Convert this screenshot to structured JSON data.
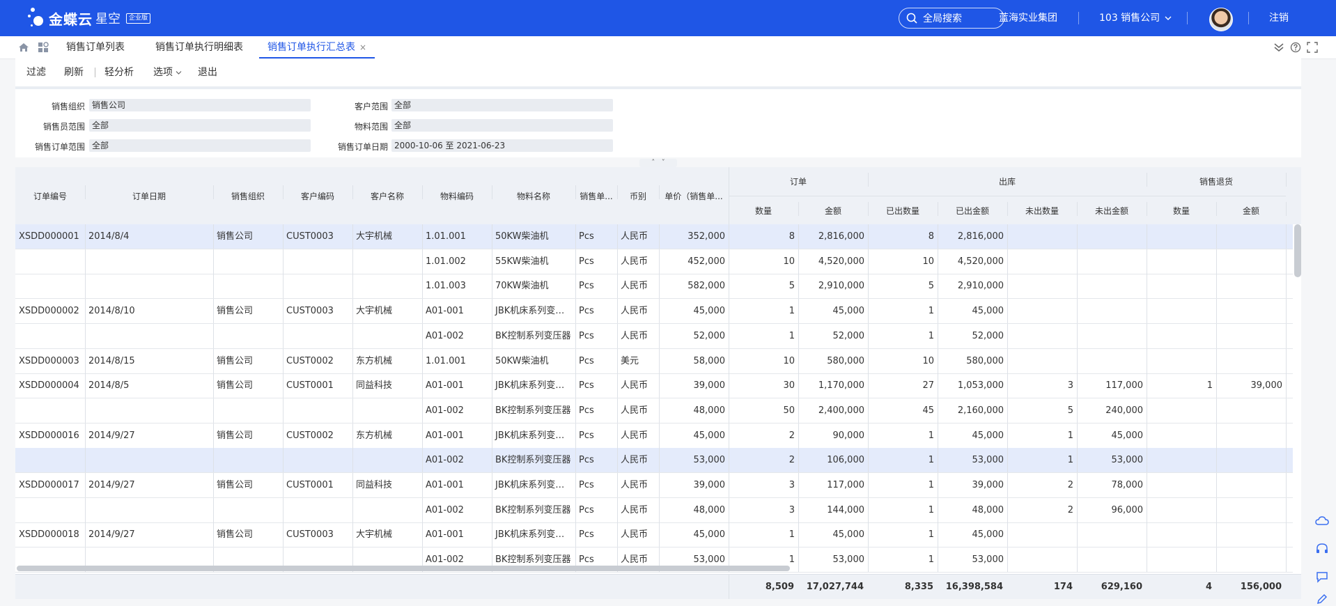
{
  "brand": {
    "name": "金蝶云",
    "sub": "星空",
    "badge": "企业版"
  },
  "topbar": {
    "search_label": "全局搜索",
    "group": "蓝海实业集团",
    "company": "103 销售公司",
    "logout": "注销"
  },
  "tabs": [
    {
      "label": "销售订单列表"
    },
    {
      "label": "销售订单执行明细表"
    },
    {
      "label": "销售订单执行汇总表",
      "close": "×"
    }
  ],
  "toolbar": {
    "filter": "过滤",
    "refresh": "刷新",
    "analysis": "轻分析",
    "options": "选项",
    "exit": "退出"
  },
  "filters": {
    "org": {
      "label": "销售组织",
      "value": "销售公司"
    },
    "sales_rep": {
      "label": "销售员范围",
      "value": "全部"
    },
    "order_range": {
      "label": "销售订单范围",
      "value": "全部"
    },
    "customer": {
      "label": "客户范围",
      "value": "全部"
    },
    "material": {
      "label": "物料范围",
      "value": "全部"
    },
    "date": {
      "label": "销售订单日期",
      "value": "2000-10-06 至 2021-06-23"
    }
  },
  "collapse": {
    "up": "˄",
    "down": "˅"
  },
  "columns": {
    "order_no": "订单编号",
    "order_date": "订单日期",
    "org": "销售组织",
    "cust_code": "客户编码",
    "cust_name": "客户名称",
    "mat_code": "物料编码",
    "mat_name": "物料名称",
    "unit": "销售单...",
    "currency": "币别",
    "price": "单价（销售单...",
    "group_order": "订单",
    "group_out": "出库",
    "group_return": "销售退货",
    "qty": "数量",
    "amount": "金额",
    "out_qty": "已出数量",
    "out_amount": "已出金额",
    "unout_qty": "未出数量",
    "unout_amount": "未出金额",
    "ret_qty": "数量",
    "ret_amount": "金额"
  },
  "rows": [
    [
      "XSDD000001",
      "2014/8/4",
      "销售公司",
      "CUST0003",
      "大宇机械",
      "1.01.001",
      "50KW柴油机",
      "Pcs",
      "人民币",
      "352,000",
      "8",
      "2,816,000",
      "8",
      "2,816,000",
      "",
      "",
      "",
      ""
    ],
    [
      "",
      "",
      "",
      "",
      "",
      "1.01.002",
      "55KW柴油机",
      "Pcs",
      "人民币",
      "452,000",
      "10",
      "4,520,000",
      "10",
      "4,520,000",
      "",
      "",
      "",
      ""
    ],
    [
      "",
      "",
      "",
      "",
      "",
      "1.01.003",
      "70KW柴油机",
      "Pcs",
      "人民币",
      "582,000",
      "5",
      "2,910,000",
      "5",
      "2,910,000",
      "",
      "",
      "",
      ""
    ],
    [
      "XSDD000002",
      "2014/8/10",
      "销售公司",
      "CUST0003",
      "大宇机械",
      "A01-001",
      "JBK机床系列变压...",
      "Pcs",
      "人民币",
      "45,000",
      "1",
      "45,000",
      "1",
      "45,000",
      "",
      "",
      "",
      ""
    ],
    [
      "",
      "",
      "",
      "",
      "",
      "A01-002",
      "BK控制系列变压器",
      "Pcs",
      "人民币",
      "52,000",
      "1",
      "52,000",
      "1",
      "52,000",
      "",
      "",
      "",
      ""
    ],
    [
      "XSDD000003",
      "2014/8/15",
      "销售公司",
      "CUST0002",
      "东方机械",
      "1.01.001",
      "50KW柴油机",
      "Pcs",
      "美元",
      "58,000",
      "10",
      "580,000",
      "10",
      "580,000",
      "",
      "",
      "",
      ""
    ],
    [
      "XSDD000004",
      "2014/8/5",
      "销售公司",
      "CUST0001",
      "同益科技",
      "A01-001",
      "JBK机床系列变压...",
      "Pcs",
      "人民币",
      "39,000",
      "30",
      "1,170,000",
      "27",
      "1,053,000",
      "3",
      "117,000",
      "1",
      "39,000"
    ],
    [
      "",
      "",
      "",
      "",
      "",
      "A01-002",
      "BK控制系列变压器",
      "Pcs",
      "人民币",
      "48,000",
      "50",
      "2,400,000",
      "45",
      "2,160,000",
      "5",
      "240,000",
      "",
      ""
    ],
    [
      "XSDD000016",
      "2014/9/27",
      "销售公司",
      "CUST0002",
      "东方机械",
      "A01-001",
      "JBK机床系列变压...",
      "Pcs",
      "人民币",
      "45,000",
      "2",
      "90,000",
      "1",
      "45,000",
      "1",
      "45,000",
      "",
      ""
    ],
    [
      "",
      "",
      "",
      "",
      "",
      "A01-002",
      "BK控制系列变压器",
      "Pcs",
      "人民币",
      "53,000",
      "2",
      "106,000",
      "1",
      "53,000",
      "1",
      "53,000",
      "",
      ""
    ],
    [
      "XSDD000017",
      "2014/9/27",
      "销售公司",
      "CUST0001",
      "同益科技",
      "A01-001",
      "JBK机床系列变压...",
      "Pcs",
      "人民币",
      "39,000",
      "3",
      "117,000",
      "1",
      "39,000",
      "2",
      "78,000",
      "",
      ""
    ],
    [
      "",
      "",
      "",
      "",
      "",
      "A01-002",
      "BK控制系列变压器",
      "Pcs",
      "人民币",
      "48,000",
      "3",
      "144,000",
      "1",
      "48,000",
      "2",
      "96,000",
      "",
      ""
    ],
    [
      "XSDD000018",
      "2014/9/27",
      "销售公司",
      "CUST0003",
      "大宇机械",
      "A01-001",
      "JBK机床系列变压...",
      "Pcs",
      "人民币",
      "45,000",
      "1",
      "45,000",
      "1",
      "45,000",
      "",
      "",
      "",
      ""
    ],
    [
      "",
      "",
      "",
      "",
      "",
      "A01-002",
      "BK控制系列变压器",
      "Pcs",
      "人民币",
      "53,000",
      "1",
      "53,000",
      "1",
      "53,000",
      "",
      "",
      "",
      ""
    ]
  ],
  "selected_rows": [
    0,
    9
  ],
  "totals": {
    "qty": "8,509",
    "amount": "17,027,744",
    "out_qty": "8,335",
    "out_amount": "16,398,584",
    "unout_qty": "174",
    "unout_amount": "629,160",
    "ret_qty": "4",
    "ret_amount": "156,000"
  },
  "colors": {
    "brand": "#1f56e6",
    "header_bg": "#eef1f6",
    "selected_row": "#e4ebfb"
  }
}
